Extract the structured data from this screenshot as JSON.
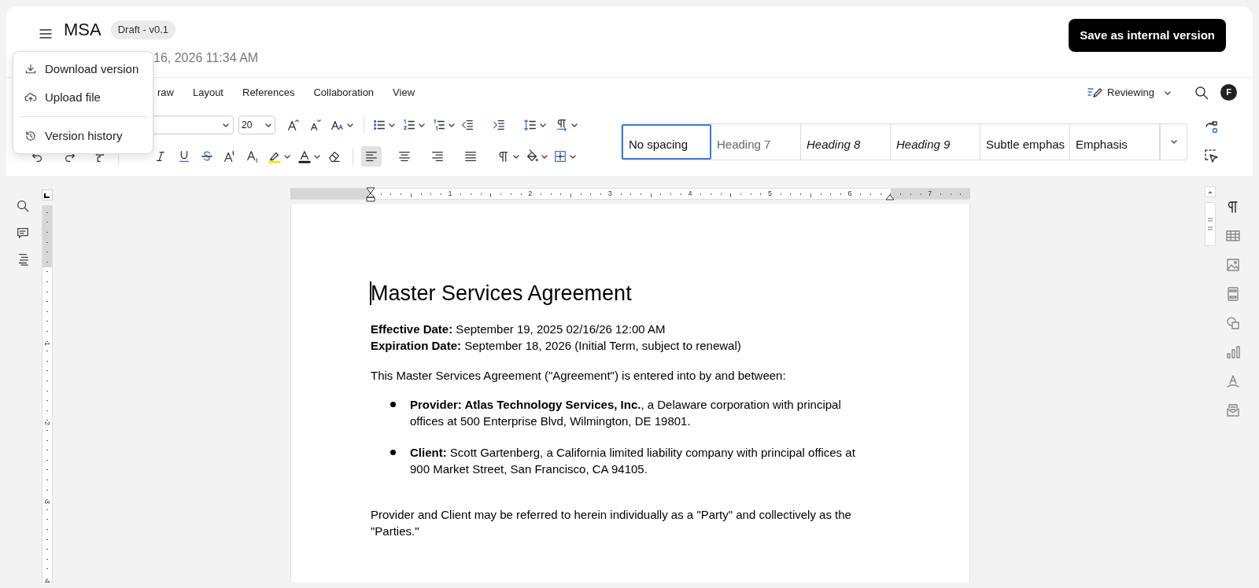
{
  "header": {
    "title": "MSA",
    "badge": "Draft - v0.1",
    "subtitle": "16, 2026 11:34 AM",
    "save_button": "Save as internal version"
  },
  "menu_popup": {
    "items": [
      {
        "label": "Download version",
        "kind": "download"
      },
      {
        "label": "Upload file",
        "kind": "upload"
      },
      {
        "label": "Version history",
        "kind": "history"
      }
    ]
  },
  "ribbon_tabs": [
    {
      "label": "raw",
      "selected": false
    },
    {
      "label": "Layout",
      "selected": false
    },
    {
      "label": "References",
      "selected": false
    },
    {
      "label": "Collaboration",
      "selected": false
    },
    {
      "label": "View",
      "selected": false
    }
  ],
  "mode": {
    "label": "Reviewing"
  },
  "avatar": "F",
  "toolbar": {
    "font_size": "20",
    "alignment": [
      {
        "selected": true
      },
      {
        "selected": false
      },
      {
        "selected": false
      },
      {
        "selected": false
      }
    ],
    "styles": [
      {
        "label": "No spacing",
        "kind": "plain",
        "selected": true
      },
      {
        "label": "Heading 7",
        "kind": "muted",
        "selected": false
      },
      {
        "label": "Heading 8",
        "kind": "italic",
        "selected": false
      },
      {
        "label": "Heading 9",
        "kind": "italic",
        "selected": false
      },
      {
        "label": "Subtle emphas",
        "kind": "plain",
        "selected": false
      },
      {
        "label": "Emphasis",
        "kind": "plain",
        "selected": false
      }
    ]
  },
  "rulers": {
    "horizontal": [
      "1",
      "2",
      "3",
      "4",
      "5",
      "6",
      "7"
    ],
    "vertical": [
      "1",
      "2",
      "3",
      "4"
    ]
  },
  "document": {
    "title": "Master Services Agreement",
    "dates": [
      "**Effective Date:** September 19, 2025 02/16/26 12:00 AM",
      "**Expiration Date:** September 18, 2026 (Initial Term, subject to renewal)"
    ],
    "intro": "This Master Services Agreement (\"Agreement\") is entered into by and between:",
    "parties": [
      "**Provider: Atlas Technology Services, Inc.**, a Delaware corporation with principal offices at 500 Enterprise Blvd, Wilmington, DE 19801.",
      "**Client:** Scott Gartenberg, a California limited liability company with principal offices at 900 Market Street, San Francisco, CA 94105."
    ],
    "closing": "Provider and Client may be referred to herein individually as a \"Party\" and collectively as the \"Parties.\""
  }
}
